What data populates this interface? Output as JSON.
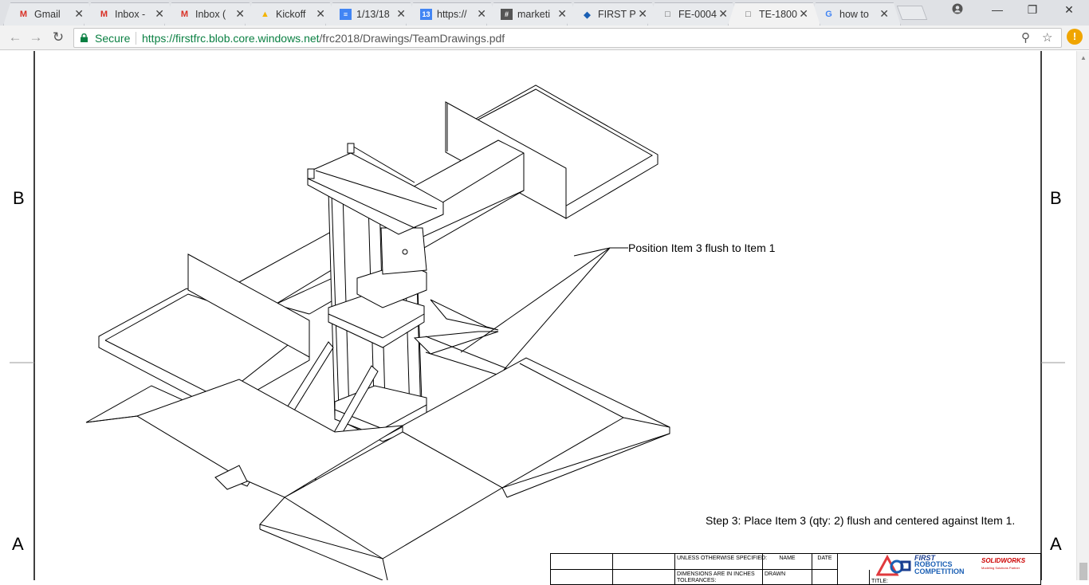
{
  "browser": {
    "tabs": [
      {
        "icon": "gmail-icon",
        "label": "Gmail",
        "active": false
      },
      {
        "icon": "gmail-icon",
        "label": "Inbox -",
        "active": false
      },
      {
        "icon": "gmail-icon",
        "label": "Inbox (",
        "active": false
      },
      {
        "icon": "google-drive-icon",
        "label": "Kickoff",
        "active": false
      },
      {
        "icon": "google-docs-icon",
        "label": "1/13/18",
        "active": false
      },
      {
        "icon": "calendar-icon",
        "label": "https://",
        "active": false
      },
      {
        "icon": "slack-icon",
        "label": "marketi",
        "active": false
      },
      {
        "icon": "first-logo-icon",
        "label": "FIRST P",
        "active": false
      },
      {
        "icon": "document-icon",
        "label": "FE-0004",
        "active": false
      },
      {
        "icon": "document-icon",
        "label": "TE-1800",
        "active": true
      },
      {
        "icon": "google-icon",
        "label": "how to",
        "active": false
      }
    ],
    "security_label": "Secure",
    "url_host": "https://firstfrc.blob.core.windows.net",
    "url_path": "/frc2018/Drawings/TeamDrawings.pdf",
    "alert_badge": "!"
  },
  "drawing": {
    "zone_labels": {
      "left_top": "B",
      "right_top": "B",
      "left_bottom": "A",
      "right_bottom": "A"
    },
    "callout": "Position Item 3 flush to Item 1",
    "step_note": "Step 3: Place Item 3 (qty: 2) flush and centered against Item 1.",
    "title_block": {
      "unless": "UNLESS OTHERWISE SPECIFIED:",
      "name": "NAME",
      "date": "DATE",
      "dims": "DIMENSIONS ARE IN INCHES",
      "tolerances": "TOLERANCES:",
      "drawn": "DRAWN",
      "title": "TITLE:",
      "frc_line1": "FIRST",
      "frc_line2": "ROBOTICS",
      "frc_line3": "COMPETITION",
      "sw_brand": "SOLIDWORKS",
      "sw_tagline": "Modeling Solutions Partner"
    }
  }
}
